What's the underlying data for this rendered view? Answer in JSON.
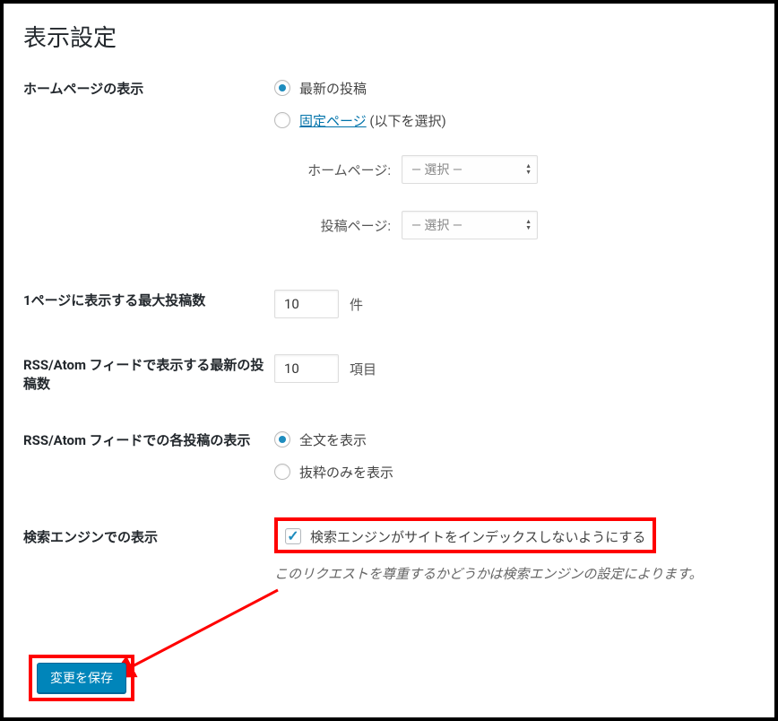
{
  "page": {
    "title": "表示設定"
  },
  "homepage": {
    "label": "ホームページの表示",
    "option_latest": "最新の投稿",
    "option_static_link": "固定ページ",
    "option_static_suffix": " (以下を選択)",
    "homepage_label": "ホームページ:",
    "posts_page_label": "投稿ページ:",
    "select_placeholder": "— 選択 —"
  },
  "posts_per_page": {
    "label": "1ページに表示する最大投稿数",
    "value": "10",
    "unit": "件"
  },
  "rss_items": {
    "label": "RSS/Atom フィードで表示する最新の投稿数",
    "value": "10",
    "unit": "項目"
  },
  "rss_display": {
    "label": "RSS/Atom フィードでの各投稿の表示",
    "option_full": "全文を表示",
    "option_excerpt": "抜粋のみを表示"
  },
  "search_engine": {
    "label": "検索エンジンでの表示",
    "checkbox_label": "検索エンジンがサイトをインデックスしないようにする",
    "description": "このリクエストを尊重するかどうかは検索エンジンの設定によります。"
  },
  "submit": {
    "label": "変更を保存"
  }
}
